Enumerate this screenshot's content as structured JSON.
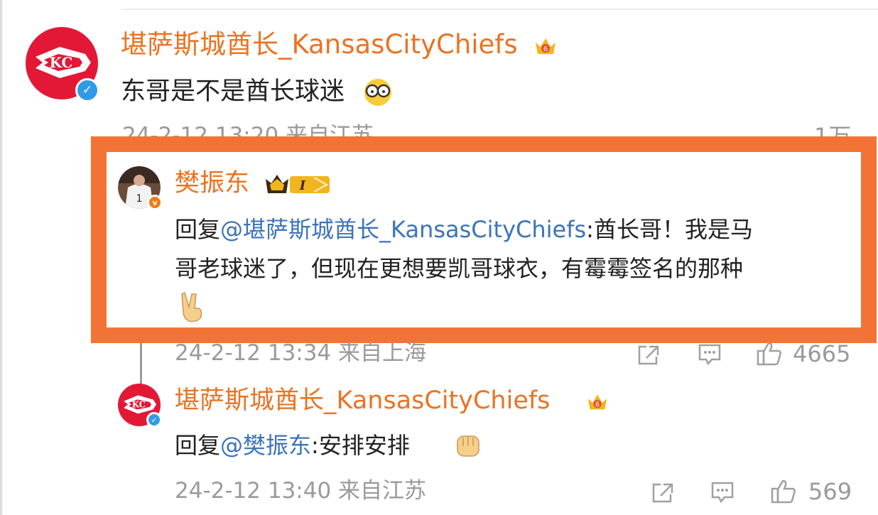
{
  "comment1": {
    "author": "堪萨斯城酋长_KansasCityChiefs",
    "author_level": "6",
    "text": "东哥是不是酋长球迷",
    "meta_partial": "24-2-12 13:20 来自江苏",
    "like_count_partial": "1万",
    "avatar_icon": "kansas-city-chiefs-logo",
    "verified_color": "#2f9be8"
  },
  "reply1": {
    "author": "樊振东",
    "vip_level": "I",
    "prefix": "回复",
    "mention": "@堪萨斯城酋长_KansasCityChiefs",
    "line1_rest": ":酋长哥！我是马",
    "line2": "哥老球迷了，但现在更想要凯哥球衣，有霉霉签名的那种",
    "emoji": "victory-hand",
    "meta": "24-2-12 13:34 来自上海",
    "like_count": "4665"
  },
  "reply2": {
    "author": "堪萨斯城酋长_KansasCityChiefs",
    "author_level": "6",
    "prefix": "回复",
    "mention": "@樊振东",
    "rest": ":安排安排",
    "emoji": "fist",
    "meta": "24-2-12 13:40 来自江苏",
    "like_count": "569"
  },
  "colors": {
    "name": "#eb7322",
    "mention": "#3d73b9",
    "highlight_border": "#f37336",
    "meta": "#9a9a9a"
  }
}
